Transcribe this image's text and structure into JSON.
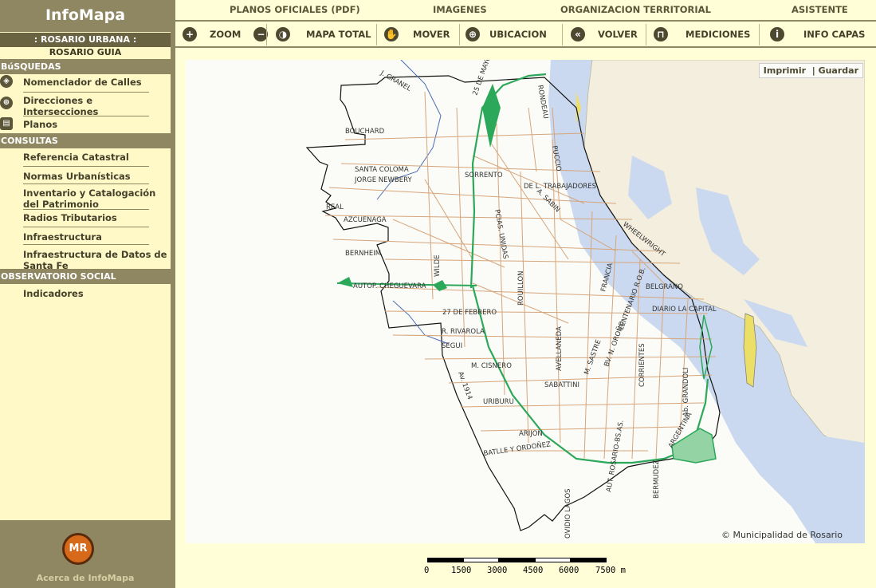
{
  "app": {
    "title": "InfoMapa"
  },
  "context": {
    "name": ": ROSARIO URBANA :",
    "guide": "ROSARIO GUIA"
  },
  "sidebar": {
    "sections": [
      {
        "title": "BúSQUEDAS",
        "items": [
          {
            "label": "Nomenclador de Calles",
            "icon": "target-icon"
          },
          {
            "label": "Direcciones e Intersecciones",
            "icon": "crosshair-icon"
          },
          {
            "label": "Planos",
            "icon": "document-icon"
          }
        ]
      },
      {
        "title": "CONSULTAS",
        "items": [
          {
            "label": "Referencia Catastral"
          },
          {
            "label": "Normas Urbanísticas"
          },
          {
            "label": "Inventario y Catalogación del Patrimonio"
          },
          {
            "label": "Radios Tributarios"
          },
          {
            "label": "Infraestructura"
          },
          {
            "label": "Infraestructura de Datos de Santa Fe"
          }
        ]
      },
      {
        "title": "OBSERVATORIO SOCIAL",
        "items": [
          {
            "label": "Indicadores"
          }
        ]
      }
    ],
    "footer": {
      "logo_text": "MR",
      "about_label": "Acerca de InfoMapa"
    }
  },
  "top_menu": [
    "PLANOS OFICIALES (PDF)",
    "IMAGENES",
    "ORGANIZACION TERRITORIAL",
    "ASISTENTE"
  ],
  "toolbar": {
    "zoom_label": "ZOOM",
    "full_map_label": "MAPA TOTAL",
    "move_label": "MOVER",
    "location_label": "UBICACION",
    "back_label": "VOLVER",
    "measure_label": "MEDICIONES",
    "info_label": "INFO CAPAS"
  },
  "map": {
    "print_label": "Imprimir",
    "save_label": "Guardar",
    "copyright": "© Municipalidad de Rosario",
    "colors": {
      "water": "#cad9f0",
      "islands": "#f3eedd",
      "streets": "#d6a57b",
      "parks": "#2ca85a",
      "boundary": "#111111"
    },
    "streets": [
      "J. GRANEL",
      "BOUCHARD",
      "SANTA COLOMA",
      "JORGE NEWBERY",
      "REAL",
      "AZCUENAGA",
      "BERNHEIM",
      "WILDE",
      "AUTOP. CHEGUEVARA",
      "27 DE FEBRERO",
      "R. RIVAROLA",
      "SEGUI",
      "Av. 1914",
      "M. CISNERO",
      "URIBURU",
      "ARIJON",
      "BATLLE Y ORDOÑEZ",
      "SABATTINI",
      "AVELLANEDA",
      "ROUILLON",
      "PCIAS. UNIDAS",
      "25 DE MAYO",
      "SORRENTO",
      "DE L. TRABAJADORES",
      "A. SABIN",
      "RONDEAU",
      "PUCCIO",
      "WHEELWRIGHT",
      "FRANCIA",
      "BELGRANO",
      "DIARIO LA CAPITAL",
      "CENTENARIO R.O.B.",
      "BV. N. OROÑO",
      "M. SASTRE",
      "CORRIENTES",
      "Ab. GRANDOLI",
      "ARGENTINA",
      "AUT. ROSARIO-BS.AS.",
      "BERMUDEZ",
      "OVIDIO LAGOS"
    ]
  },
  "scale": {
    "ticks": [
      "0",
      "1500",
      "3000",
      "4500",
      "6000",
      "7500 m"
    ]
  }
}
